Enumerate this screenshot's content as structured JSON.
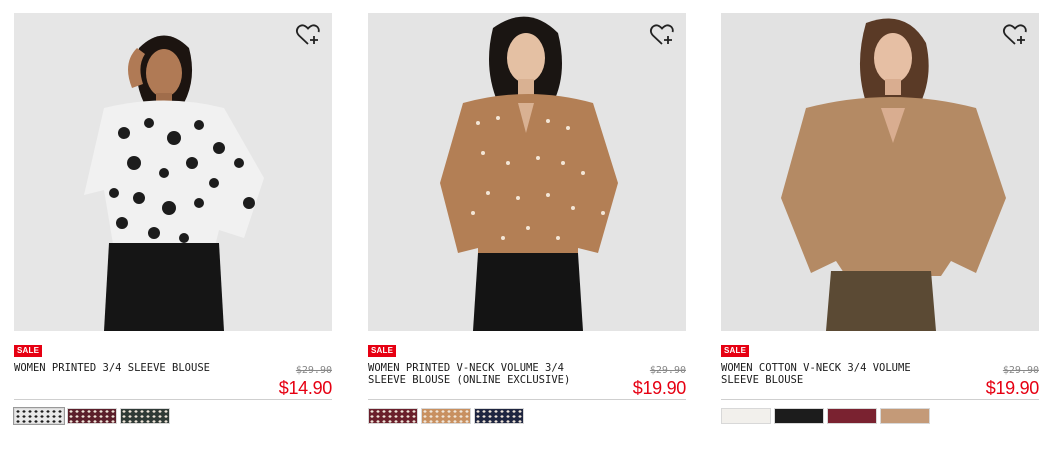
{
  "colors": {
    "sale_red": "#e60012",
    "price_red": "#e60012",
    "rule": "#cfcfcf"
  },
  "products": [
    {
      "badge": "SALE",
      "name": "WOMEN PRINTED 3/4 SLEEVE BLOUSE",
      "original_price": "$29.90",
      "sale_price": "$14.90",
      "wishlist_icon": "heart-plus-icon",
      "swatches": [
        {
          "name": "white floral print",
          "color": "#e8e8e8",
          "pattern": "print-dark"
        },
        {
          "name": "wine print",
          "color": "#5b1e2a",
          "pattern": "print-light"
        },
        {
          "name": "dark green print",
          "color": "#2f3a36",
          "pattern": "print-light"
        }
      ]
    },
    {
      "badge": "SALE",
      "name": "WOMEN PRINTED V-NECK VOLUME 3/4 SLEEVE BLOUSE (ONLINE EXCLUSIVE)",
      "original_price": "$29.90",
      "sale_price": "$19.90",
      "wishlist_icon": "heart-plus-icon",
      "swatches": [
        {
          "name": "wine print",
          "color": "#6a1f2b",
          "pattern": "print-light"
        },
        {
          "name": "brown print",
          "color": "#c89060",
          "pattern": "print-light"
        },
        {
          "name": "navy print",
          "color": "#1e2540",
          "pattern": "print-light"
        }
      ]
    },
    {
      "badge": "SALE",
      "name": "WOMEN COTTON V-NECK 3/4 VOLUME SLEEVE BLOUSE",
      "original_price": "$29.90",
      "sale_price": "$19.90",
      "wishlist_icon": "heart-plus-icon",
      "swatches": [
        {
          "name": "off white",
          "color": "#f2f0ec",
          "pattern": "solid"
        },
        {
          "name": "black",
          "color": "#1c1c1c",
          "pattern": "solid"
        },
        {
          "name": "wine",
          "color": "#7a2230",
          "pattern": "solid"
        },
        {
          "name": "beige",
          "color": "#c49a78",
          "pattern": "solid"
        }
      ]
    }
  ]
}
